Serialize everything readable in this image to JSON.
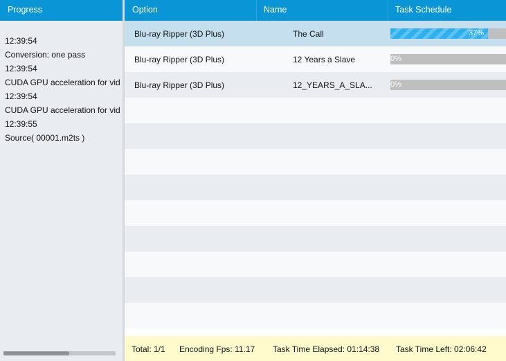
{
  "header": {
    "progress": "Progress",
    "option": "Option",
    "name": "Name",
    "task_schedule": "Task Schedule"
  },
  "log": [
    "12:39:54",
    "Conversion: one pass",
    "12:39:54",
    "CUDA GPU acceleration for vid",
    "12:39:54",
    "CUDA GPU acceleration for vid",
    "12:39:55",
    "Source( 00001.m2ts )"
  ],
  "tasks": [
    {
      "option": "Blu-ray Ripper (3D Plus)",
      "name": "The Call",
      "progress": 37,
      "progress_label": "37%"
    },
    {
      "option": "Blu-ray Ripper (3D Plus)",
      "name": "12 Years a Slave",
      "progress": 0,
      "progress_label": "0%"
    },
    {
      "option": "Blu-ray Ripper (3D Plus)",
      "name": "12_YEARS_A_SLA...",
      "progress": 0,
      "progress_label": "0%"
    }
  ],
  "footer": {
    "total": "Total: 1/1",
    "fps": "Encoding Fps: 11.17",
    "elapsed": "Task Time Elapsed: 01:14:38",
    "left": "Task Time Left: 02:06:42"
  }
}
